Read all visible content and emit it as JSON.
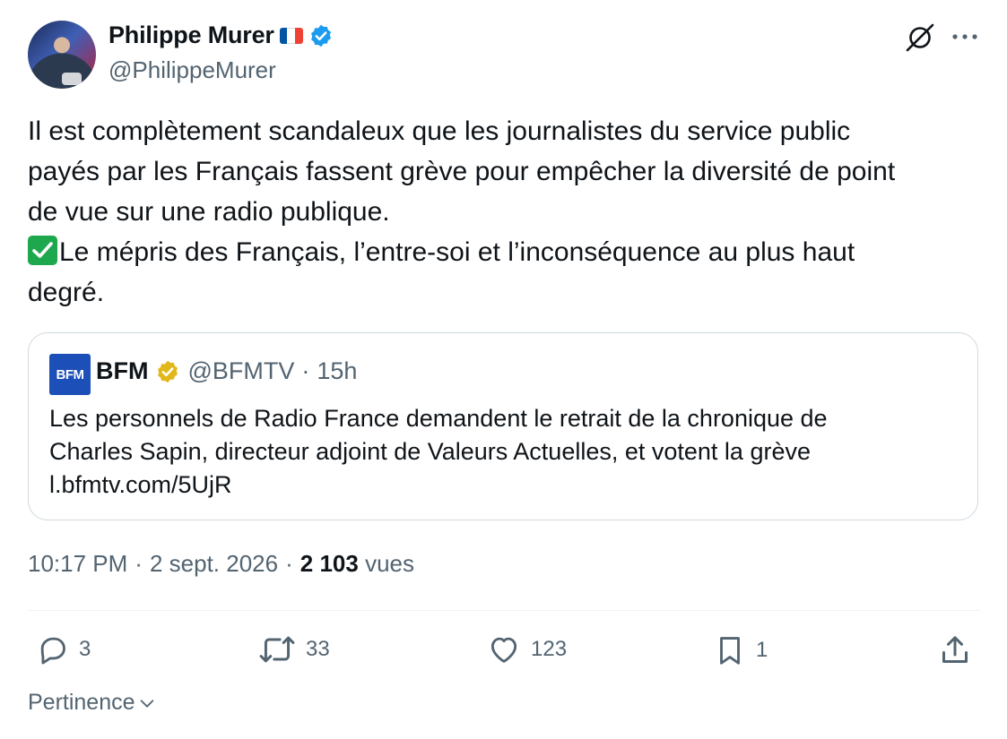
{
  "author": {
    "name": "Philippe Murer",
    "handle": "@PhilippeMurer",
    "flag_colors": [
      "#0055a4",
      "#ffffff",
      "#ef4135"
    ],
    "verified_color": "#1d9bf0"
  },
  "tweet": {
    "text_lines": [
      "Il est complètement scandaleux que les journalistes du service public",
      "payés par les Français fassent grève pour empêcher la diversité de point",
      "de vue sur une radio publique."
    ],
    "emoji_line": "Le mépris des Français, l’entre-soi et l’inconséquence au plus haut",
    "last_line": "degré."
  },
  "quote": {
    "logo_text": "BFM",
    "name": "BFM",
    "handle": "@BFMTV",
    "time": "15h",
    "lines": [
      "Les personnels de Radio France demandent le retrait de la chronique de",
      "Charles Sapin, directeur adjoint de Valeurs Actuelles, et votent la grève",
      "l.bfmtv.com/5UjR"
    ],
    "verified_color": "#e2b719"
  },
  "meta": {
    "time": "10:17 PM",
    "date": "2 sept. 2026",
    "views_count": "2 103",
    "views_label": "vues"
  },
  "actions": {
    "replies": "3",
    "reposts": "33",
    "likes": "123",
    "bookmarks": "1"
  },
  "sort": {
    "label": "Pertinence"
  },
  "icons": [
    "grok-icon",
    "more-icon",
    "reply-icon",
    "repost-icon",
    "like-icon",
    "bookmark-icon",
    "share-icon",
    "chevron-down-icon",
    "verified-badge-icon",
    "check-emoji-icon"
  ]
}
